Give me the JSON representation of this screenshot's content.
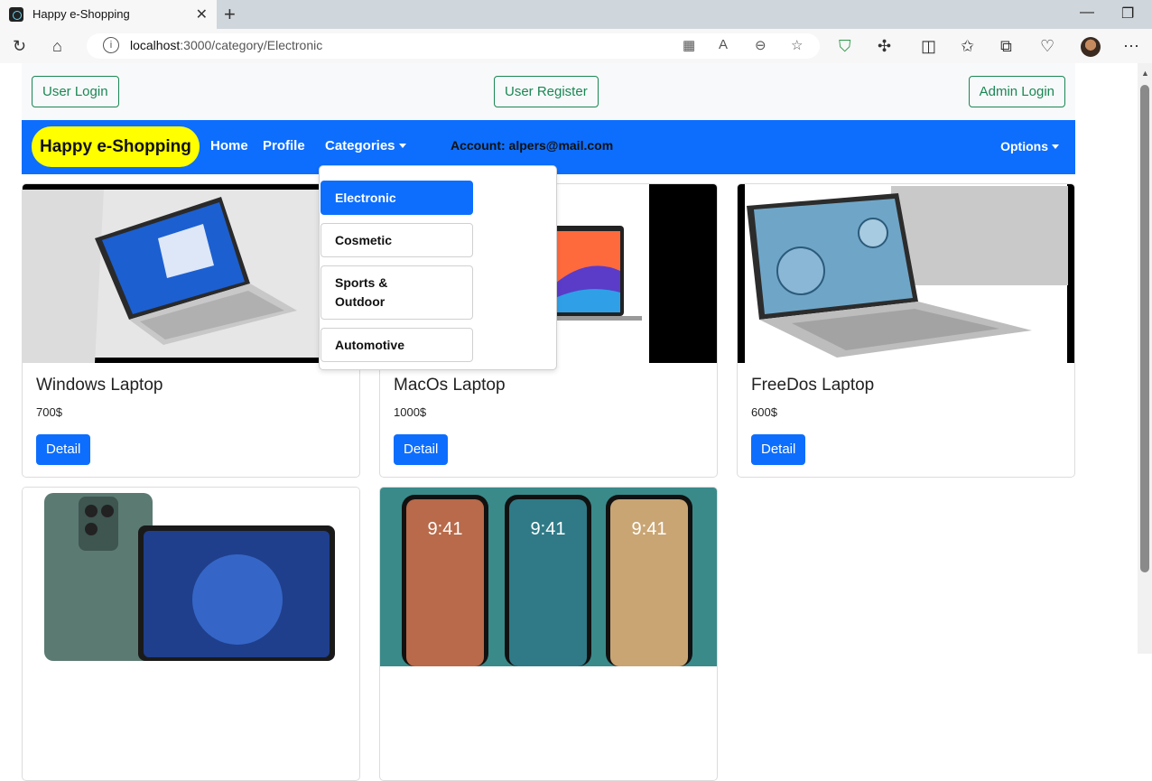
{
  "browser": {
    "tab_title": "Happy e-Shopping",
    "url_host": "localhost",
    "url_rest": ":3000/category/Electronic"
  },
  "top_buttons": {
    "user_login": "User Login",
    "user_register": "User Register",
    "admin_login": "Admin Login"
  },
  "navbar": {
    "brand": "Happy e-Shopping",
    "home": "Home",
    "profile": "Profile",
    "categories": "Categories",
    "account": "Account: alpers@mail.com",
    "options": "Options"
  },
  "dropdown": {
    "items": [
      "Electronic",
      "Cosmetic",
      "Sports & Outdoor",
      "Automotive"
    ],
    "active": "Electronic"
  },
  "products": [
    {
      "name": "Windows Laptop",
      "price": "700$",
      "button": "Detail"
    },
    {
      "name": "MacOs Laptop",
      "price": "1000$",
      "button": "Detail"
    },
    {
      "name": "FreeDos Laptop",
      "price": "600$",
      "button": "Detail"
    }
  ],
  "colors": {
    "primary": "#0d6efd",
    "brand_bg": "#ffff00",
    "outline": "#198754"
  }
}
